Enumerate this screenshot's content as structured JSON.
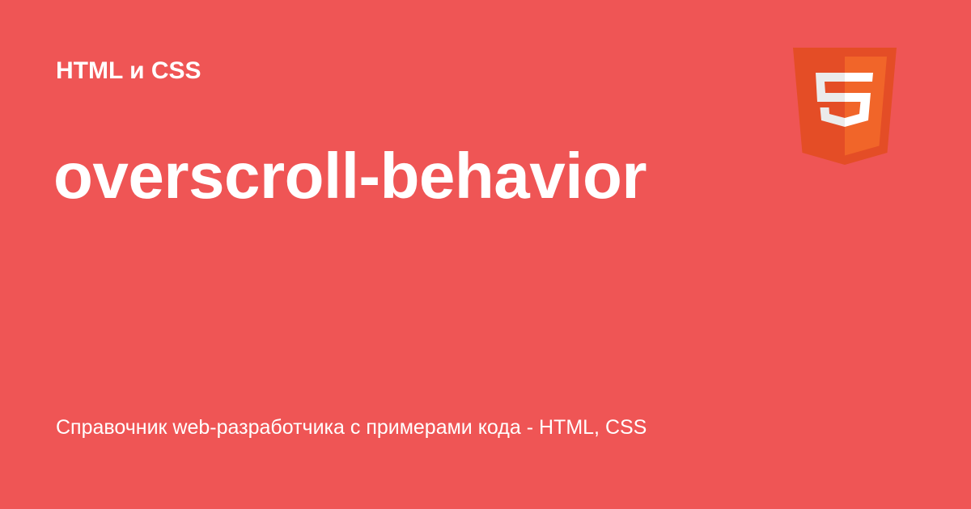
{
  "card": {
    "category": "HTML и CSS",
    "title": "overscroll-behavior",
    "subtitle": "Справочник web-разработчика с примерами кода - HTML, CSS"
  },
  "logo": {
    "icon": "html5-logo-icon",
    "glyph": "5"
  },
  "colors": {
    "background": "#EF5555",
    "text": "#FFFFFF",
    "logo_dark": "#E44D26",
    "logo_light": "#F16529",
    "logo_glyph_shade": "#EBEBEB"
  }
}
